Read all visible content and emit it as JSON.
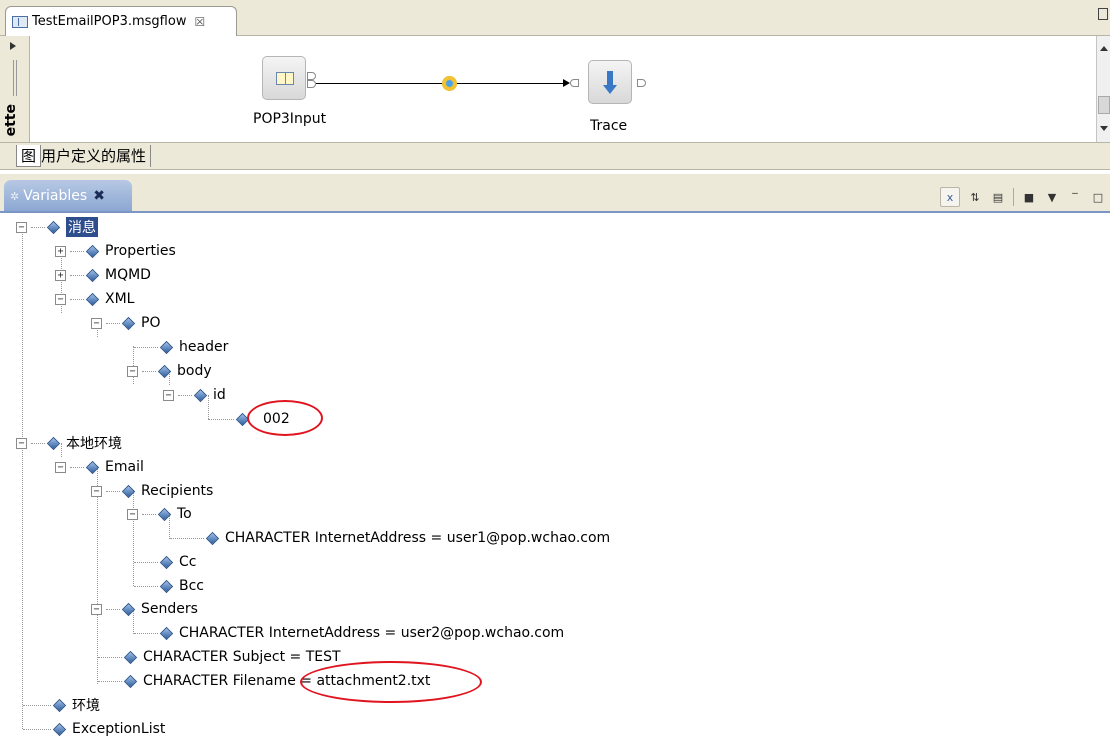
{
  "editor": {
    "tab_label": "TestEmailPOP3.msgflow",
    "tab_close": "☒",
    "palette_label": "ette",
    "nodes": [
      {
        "label": "POP3Input"
      },
      {
        "label": "Trace"
      }
    ],
    "sub_tabs": [
      "图",
      "用户定义的属性"
    ]
  },
  "variables_view": {
    "tab_label": "Variables",
    "tab_close": "✖",
    "toolbar": [
      "x-icon",
      "collapse-icon",
      "layout-icon",
      "maximize-icon",
      "menu-icon",
      "minimize-icon"
    ]
  },
  "tree": {
    "message": "消息",
    "properties": "Properties",
    "mqmd": "MQMD",
    "xml": "XML",
    "po": "PO",
    "header": "header",
    "body": "body",
    "id": "id",
    "id_value": "002",
    "local_env": "本地环境",
    "email": "Email",
    "recipients": "Recipients",
    "to": "To",
    "to_address": "CHARACTER  InternetAddress = user1@pop.wchao.com",
    "cc": "Cc",
    "bcc": "Bcc",
    "senders": "Senders",
    "sender_address": "CHARACTER  InternetAddress = user2@pop.wchao.com",
    "subject": "CHARACTER  Subject = TEST",
    "filename": "CHARACTER  Filename = attachment2.txt",
    "environment": "环境",
    "exception_list": "ExceptionList"
  },
  "colors": {
    "accent": "#2e4d8c",
    "highlight": "#e0141e"
  }
}
